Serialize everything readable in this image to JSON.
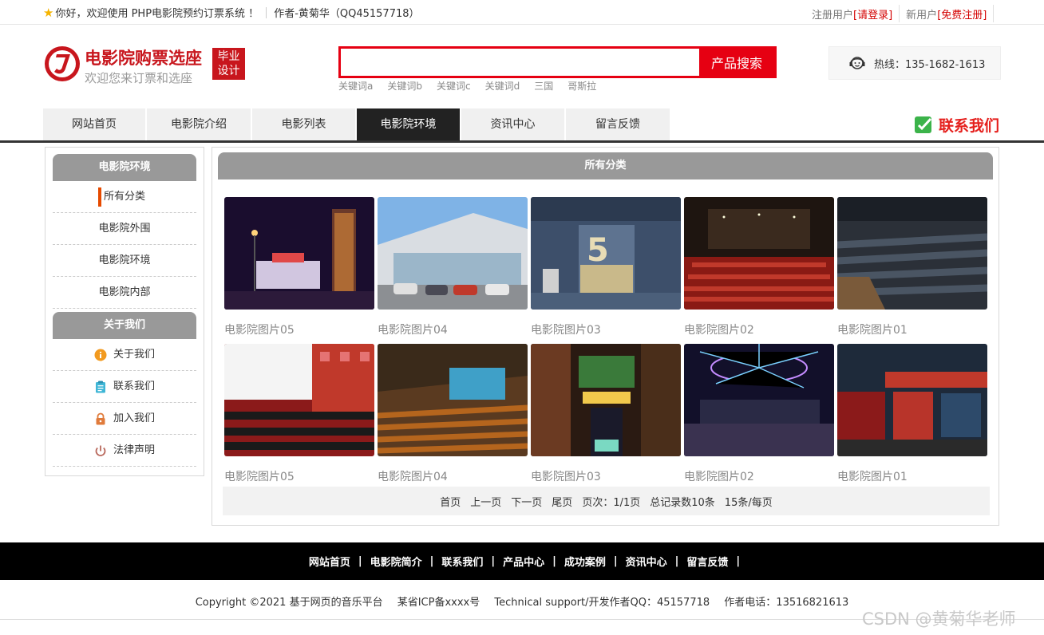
{
  "topbar": {
    "welcome": "你好，欢迎使用 PHP电影院预约订票系统 ！",
    "author": "作者-黄菊华（QQ45157718）",
    "registered_user": "注册用户",
    "login_link": "[请登录]",
    "new_user": "新用户",
    "register_link": "[免费注册]"
  },
  "header": {
    "logo_title": "电影院购票选座",
    "logo_subtitle": "欢迎您来订票和选座",
    "logo_badge_line1": "毕业",
    "logo_badge_line2": "设计",
    "search_placeholder": "",
    "search_button": "产品搜索",
    "keywords": [
      "关键词a",
      "关键词b",
      "关键词c",
      "关键词d",
      "三国",
      "哥斯拉"
    ],
    "hotline": "热线：135-1682-1613"
  },
  "nav": {
    "items": [
      "网站首页",
      "电影院介绍",
      "电影列表",
      "电影院环境",
      "资讯中心",
      "留言反馈"
    ],
    "active_index": 3,
    "contact_label": "联系我们"
  },
  "sidebar": {
    "section1_title": "电影院环境",
    "section1_items": [
      "所有分类",
      "电影院外围",
      "电影院环境",
      "电影院内部"
    ],
    "section2_title": "关于我们",
    "section2_items": [
      {
        "label": "关于我们",
        "icon": "info-circle-icon"
      },
      {
        "label": "联系我们",
        "icon": "clipboard-icon"
      },
      {
        "label": "加入我们",
        "icon": "lock-icon"
      },
      {
        "label": "法律声明",
        "icon": "power-icon"
      }
    ]
  },
  "main": {
    "title": "所有分类",
    "gallery": [
      {
        "caption": "电影院图片05"
      },
      {
        "caption": "电影院图片04"
      },
      {
        "caption": "电影院图片03"
      },
      {
        "caption": "电影院图片02"
      },
      {
        "caption": "电影院图片01"
      },
      {
        "caption": "电影院图片05"
      },
      {
        "caption": "电影院图片04"
      },
      {
        "caption": "电影院图片03"
      },
      {
        "caption": "电影院图片02"
      },
      {
        "caption": "电影院图片01"
      }
    ],
    "pager": [
      "首页",
      "上一页",
      "下一页",
      "尾页",
      "页次：1/1页",
      "总记录数10条",
      "15条/每页"
    ]
  },
  "footer": {
    "links": [
      "网站首页",
      "电影院简介",
      "联系我们",
      "产品中心",
      "成功案例",
      "资讯中心",
      "留言反馈"
    ],
    "copyright": "Copyright ©2021 基于网页的音乐平台",
    "icp": "某省ICP备xxxx号",
    "support": "Technical support/开发作者QQ：45157718",
    "phone": "作者电话：13516821613"
  },
  "watermark": "CSDN @黄菊华老师",
  "colors": {
    "accent": "#e60012",
    "nav_active": "#222222",
    "panel_head": "#999999"
  }
}
